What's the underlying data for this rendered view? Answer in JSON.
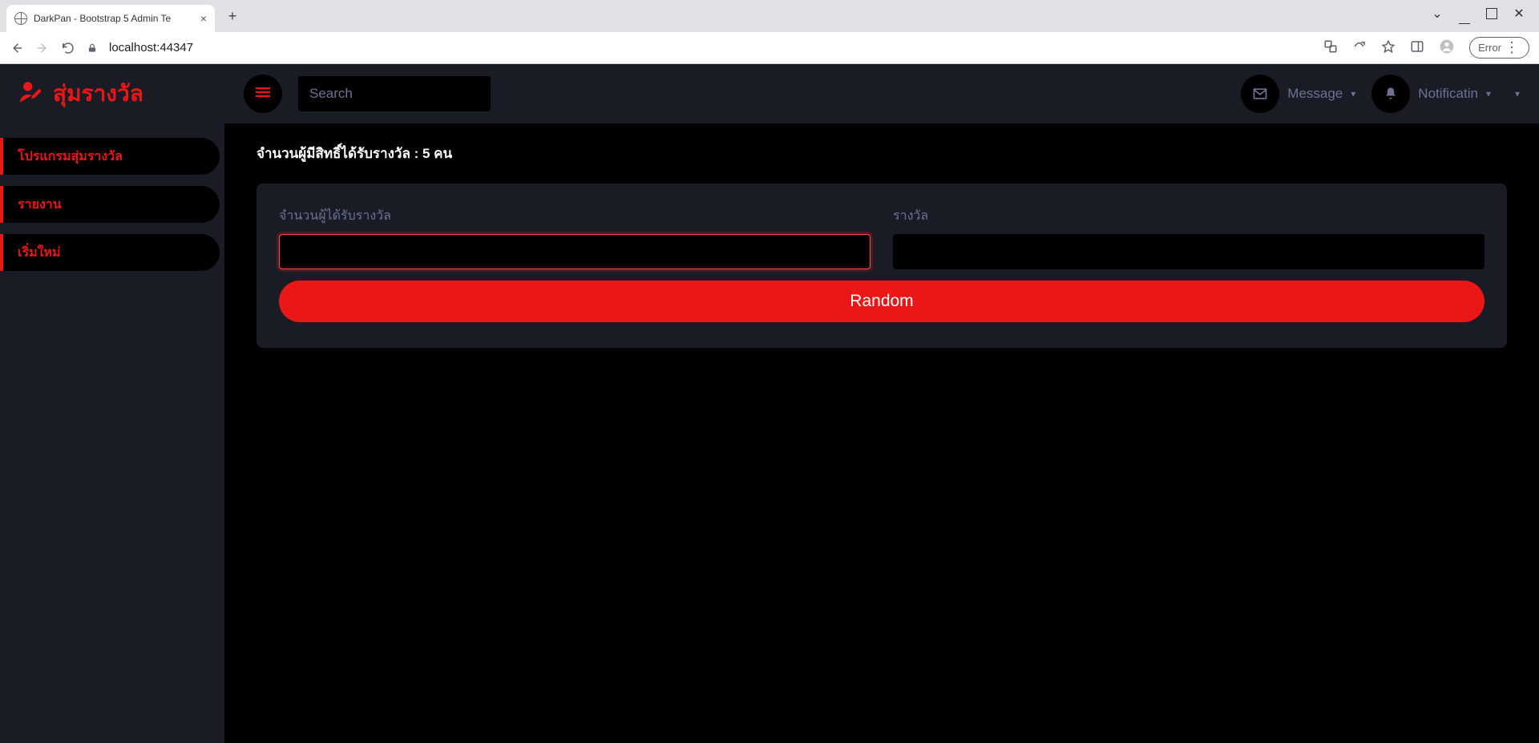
{
  "browser": {
    "tab_title": "DarkPan - Bootstrap 5 Admin Te",
    "url": "localhost:44347",
    "error_chip": "Error"
  },
  "brand": {
    "text": "สุ่มรางวัล"
  },
  "sidebar": {
    "items": [
      {
        "label": "โปรแกรมสุ่มรางวัล"
      },
      {
        "label": "รายงาน"
      },
      {
        "label": "เริ่มใหม่"
      }
    ]
  },
  "topbar": {
    "search_placeholder": "Search",
    "message_label": "Message",
    "notification_label": "Notificatin"
  },
  "content": {
    "heading": "จำนวนผู้มีสิทธิ์ได้รับรางวัล : 5 คน",
    "form": {
      "count_label": "จำนวนผู้ได้รับรางวัล",
      "prize_label": "รางวัล",
      "count_value": "",
      "prize_value": "",
      "submit_label": "Random"
    }
  }
}
